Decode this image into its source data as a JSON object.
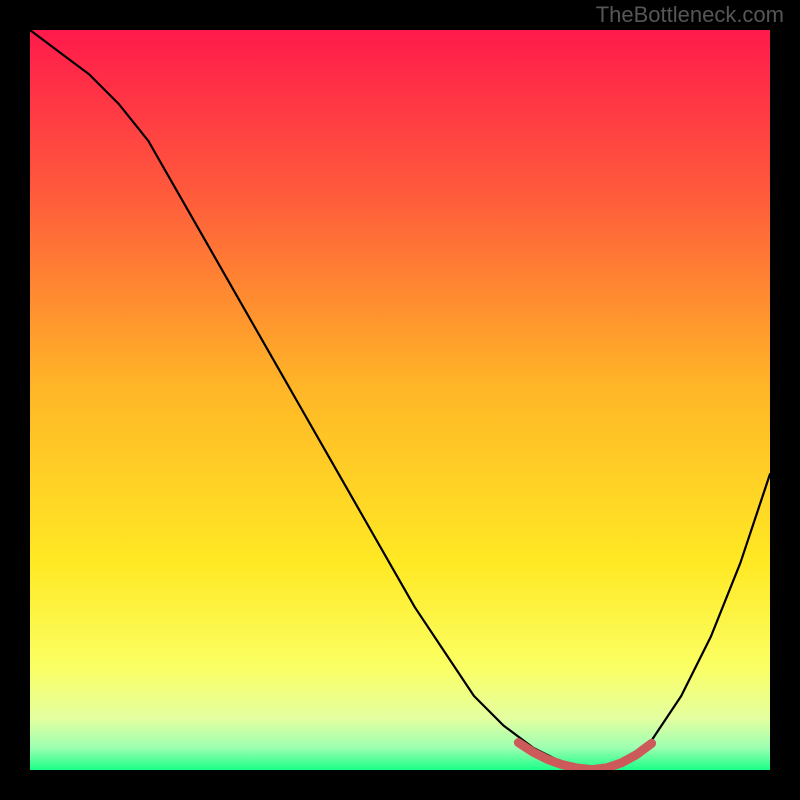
{
  "attribution": "TheBottleneck.com",
  "colors": {
    "page_bg": "#000000",
    "curve_stroke": "#000000",
    "highlight_stroke": "#cc5a5a",
    "gradient": [
      {
        "offset": 0.0,
        "hex": "#ff1a4b"
      },
      {
        "offset": 0.22,
        "hex": "#ff5a3c"
      },
      {
        "offset": 0.48,
        "hex": "#ffb527"
      },
      {
        "offset": 0.72,
        "hex": "#ffe924"
      },
      {
        "offset": 0.86,
        "hex": "#fbff63"
      },
      {
        "offset": 0.93,
        "hex": "#e4ffa0"
      },
      {
        "offset": 0.97,
        "hex": "#9dffb1"
      },
      {
        "offset": 1.0,
        "hex": "#19ff87"
      }
    ]
  },
  "chart_data": {
    "type": "line",
    "title": "",
    "xlabel": "",
    "ylabel": "",
    "xlim": [
      0,
      100
    ],
    "ylim": [
      0,
      100
    ],
    "series": [
      {
        "name": "bottleneck-curve",
        "x": [
          0,
          4,
          8,
          12,
          16,
          20,
          24,
          28,
          32,
          36,
          40,
          44,
          48,
          52,
          56,
          60,
          64,
          68,
          72,
          76,
          80,
          84,
          88,
          92,
          96,
          100
        ],
        "y": [
          100,
          97,
          94,
          90,
          85,
          78,
          71,
          64,
          57,
          50,
          43,
          36,
          29,
          22,
          16,
          10,
          6,
          3,
          1,
          0,
          1,
          4,
          10,
          18,
          28,
          40
        ]
      },
      {
        "name": "optimal-highlight",
        "x": [
          66,
          68,
          70,
          72,
          74,
          76,
          78,
          80,
          82,
          84
        ],
        "y": [
          3.7,
          2.4,
          1.4,
          0.7,
          0.25,
          0.05,
          0.3,
          1.0,
          2.1,
          3.6
        ]
      }
    ]
  }
}
